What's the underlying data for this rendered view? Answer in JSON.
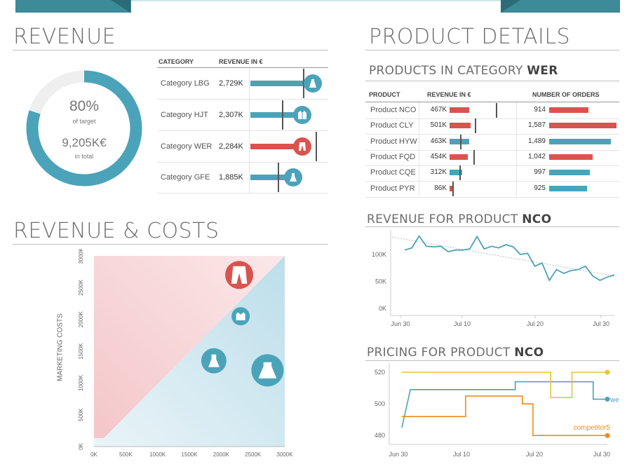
{
  "colors": {
    "blue": "#4ba3ba",
    "red": "#d9534f",
    "dark_teal": "#3d8a99",
    "yellow": "#e8c23a",
    "orange": "#ef8a1c",
    "grey_text": "#6d6d6d"
  },
  "revenue": {
    "title": "REVENUE",
    "gauge": {
      "percent": "80%",
      "percent_value": 0.8,
      "percent_caption": "of target",
      "total": "9,205K€",
      "total_caption": "in total"
    },
    "table": {
      "headers": [
        "CATEGORY",
        "REVENUE IN €"
      ],
      "rows": [
        {
          "category": "Category LBG",
          "revenue": "2,729K",
          "icon": "skirt-icon",
          "color": "blue"
        },
        {
          "category": "Category HJT",
          "revenue": "2,307K",
          "icon": "jacket-icon",
          "color": "blue"
        },
        {
          "category": "Category WER",
          "revenue": "2,284K",
          "icon": "trousers-icon",
          "color": "red"
        },
        {
          "category": "Category GFE",
          "revenue": "1,885K",
          "icon": "dress-icon",
          "color": "blue"
        }
      ]
    }
  },
  "revenue_costs": {
    "title": "REVENUE & COSTS",
    "ylabel": "MARKETING COSTS"
  },
  "product_details": {
    "title": "PRODUCT DETAILS",
    "category_title_prefix": "PRODUCTS IN CATEGORY",
    "category_title_bold": "WER",
    "headers": [
      "PRODUCT",
      "REVENUE IN €",
      "NUMBER OF ORDERS"
    ],
    "rows": [
      {
        "product": "Product NCO",
        "revenue": "467K",
        "orders": "914",
        "orders_color": "red"
      },
      {
        "product": "Product CLY",
        "revenue": "501K",
        "orders": "1,587",
        "orders_color": "red"
      },
      {
        "product": "Product HYW",
        "revenue": "463K",
        "orders": "1,489",
        "orders_color": "blue"
      },
      {
        "product": "Product FQD",
        "revenue": "454K",
        "orders": "1,042",
        "orders_color": "red"
      },
      {
        "product": "Product CQE",
        "revenue": "312K",
        "orders": "997",
        "orders_color": "blue"
      },
      {
        "product": "Product PYR",
        "revenue": "86K",
        "orders": "925",
        "orders_color": "blue"
      }
    ],
    "revenue_title_prefix": "REVENUE FOR PRODUCT",
    "revenue_title_bold": "NCO",
    "pricing_title_prefix": "PRICING FOR PRODUCT",
    "pricing_title_bold": "NCO",
    "pricing_labels": {
      "we": "we",
      "competitor": "competitor5"
    }
  },
  "chart_data": [
    {
      "type": "scatter",
      "title": "REVENUE & COSTS",
      "xlabel": "",
      "ylabel": "MARKETING COSTS",
      "xlim": [
        0,
        3000000
      ],
      "ylim": [
        0,
        3000000
      ],
      "x_ticks": [
        "0K",
        "500K",
        "1000K",
        "1500K",
        "2000K",
        "2500K",
        "3000K"
      ],
      "y_ticks": [
        "0K",
        "500K",
        "1000K",
        "1500K",
        "2000K",
        "2500K",
        "3000K"
      ],
      "points": [
        {
          "name": "trousers-icon",
          "x": 2284000,
          "y": 2700000,
          "color": "red"
        },
        {
          "name": "jacket-icon",
          "x": 2307000,
          "y": 2050000,
          "color": "blue"
        },
        {
          "name": "dress-icon",
          "x": 1885000,
          "y": 1350000,
          "color": "blue"
        },
        {
          "name": "skirt-icon",
          "x": 2729000,
          "y": 1200000,
          "color": "blue"
        }
      ]
    },
    {
      "type": "line",
      "title": "REVENUE FOR PRODUCT NCO",
      "x_ticks": [
        "Jun 30",
        "Jul 10",
        "Jul 20",
        "Jul 30"
      ],
      "y_ticks": [
        "0K",
        "50K",
        "100K"
      ],
      "ylim": [
        0,
        140000
      ],
      "x": [
        1,
        2,
        3,
        4,
        5,
        6,
        7,
        8,
        9,
        10,
        11,
        12,
        13,
        14,
        15,
        16,
        17,
        18,
        19,
        20,
        21,
        22,
        23,
        24,
        25,
        26,
        27,
        28,
        29
      ],
      "series": [
        {
          "values": [
            108000,
            112000,
            134000,
            115000,
            114000,
            115000,
            105000,
            108000,
            108000,
            110000,
            133000,
            110000,
            115000,
            112000,
            118000,
            114000,
            100000,
            102000,
            78000,
            84000,
            52000,
            72000,
            65000,
            70000,
            72000,
            78000,
            60000,
            52000,
            58000,
            62000
          ]
        }
      ],
      "trend": [
        132000,
        60000
      ]
    },
    {
      "type": "line",
      "title": "PRICING FOR PRODUCT NCO",
      "x_ticks": [
        "Jun 30",
        "Jul 10",
        "Jul 20",
        "Jul 30"
      ],
      "y_ticks": [
        "480",
        "500",
        "520"
      ],
      "ylim": [
        477,
        524
      ],
      "series": [
        {
          "name": "we",
          "color": "blue",
          "steps": [
            [
              0,
              485
            ],
            [
              1.2,
              509
            ],
            [
              16,
              509
            ],
            [
              16,
              514
            ],
            [
              27,
              514
            ],
            [
              27,
              503
            ],
            [
              29,
              503
            ]
          ]
        },
        {
          "name": "competitor5",
          "color": "orange",
          "steps": [
            [
              0,
              492
            ],
            [
              9,
              492
            ],
            [
              9,
              505
            ],
            [
              17,
              505
            ],
            [
              17,
              500
            ],
            [
              18.5,
              500
            ],
            [
              18.5,
              480
            ],
            [
              29,
              480
            ]
          ]
        },
        {
          "name": "",
          "color": "yellow",
          "steps": [
            [
              0,
              520
            ],
            [
              21,
              520
            ],
            [
              21,
              504
            ],
            [
              24,
              504
            ],
            [
              24,
              520
            ],
            [
              29,
              520
            ]
          ]
        }
      ]
    }
  ]
}
